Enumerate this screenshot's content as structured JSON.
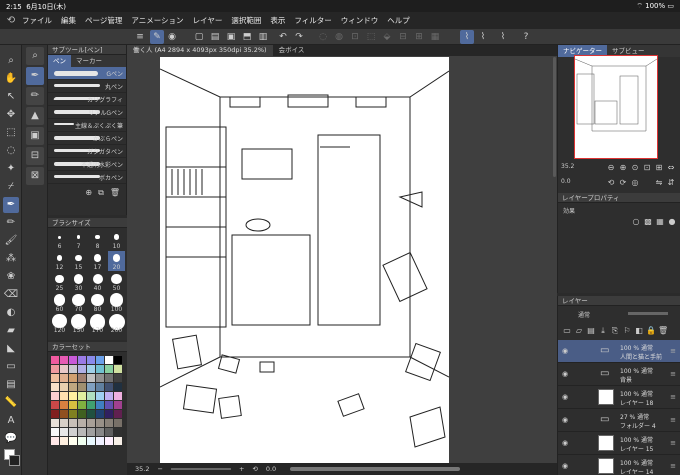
{
  "status": {
    "time": "2:15",
    "date": "6月10日(木)",
    "battery": "100%"
  },
  "menu": [
    "ファイル",
    "編集",
    "ページ管理",
    "アニメーション",
    "レイヤー",
    "選択範囲",
    "表示",
    "フィルター",
    "ウィンドウ",
    "ヘルプ"
  ],
  "subtool": {
    "title": "サブツール[ペン]",
    "tabs": [
      "ペン",
      "マーカー"
    ],
    "brushes": [
      "Gペン",
      "丸ペン",
      "カリグラフィ",
      "リアルGペン",
      "主線＆ぷくぷく筆",
      "かぶらペン",
      "ガタガタペン",
      "不透明水彩ペン",
      "ボカペン"
    ]
  },
  "brushsize": {
    "title": "ブラシサイズ",
    "sizes": [
      "6",
      "7",
      "8",
      "10",
      "12",
      "15",
      "17",
      "20",
      "25",
      "30",
      "40",
      "50",
      "60",
      "70",
      "80",
      "100",
      "120",
      "150",
      "170",
      "200"
    ],
    "selected": "20"
  },
  "colorset": {
    "title": "カラーセット"
  },
  "document": {
    "tab1": "働く人 (A4 2894 x 4093px 350dpi 35.2%)",
    "tab2": "会ボイス"
  },
  "bottombar": {
    "zoom": "35.2",
    "minus": "−",
    "plus": "+",
    "angle": "0.0"
  },
  "navigator": {
    "title": "ナビゲーター",
    "tab2": "サブビュー",
    "zoom": "35.2",
    "angle": "0.0"
  },
  "layerprop": {
    "title": "レイヤープロパティ",
    "effect": "効果"
  },
  "layers": {
    "title": "レイヤー",
    "blend": "通常",
    "rows": [
      {
        "line1": "100 % 通常",
        "line2": "人間と猫と手前",
        "type": "folder",
        "selected": true
      },
      {
        "line1": "100 % 通常",
        "line2": "背景",
        "type": "folder",
        "selected": false
      },
      {
        "line1": "100 % 通常",
        "line2": "レイヤー 18",
        "type": "layer",
        "selected": false
      },
      {
        "line1": "27 % 通常",
        "line2": "フォルダー 4",
        "type": "folder",
        "selected": false
      },
      {
        "line1": "100 % 通常",
        "line2": "レイヤー 15",
        "type": "layer",
        "selected": false
      },
      {
        "line1": "100 % 通常",
        "line2": "レイヤー 14",
        "type": "layer",
        "selected": false
      }
    ]
  },
  "swatches": [
    "#f25aa0",
    "#e85ab4",
    "#c85ad8",
    "#9a7ae6",
    "#8a8aea",
    "#6aa0ea",
    "#ffffff",
    "#000000",
    "#f09aa0",
    "#e8c8c8",
    "#c8c8d0",
    "#b0b0e6",
    "#a0d0e8",
    "#70c0d0",
    "#88d0a0",
    "#d0e0a0",
    "#f0c0a0",
    "#e0b090",
    "#d0a070",
    "#a08070",
    "#c0c0c0",
    "#909090",
    "#707070",
    "#404040",
    "#f8e0c8",
    "#e8d0b0",
    "#c0a880",
    "#a09070",
    "#80a0c0",
    "#6080a0",
    "#405070",
    "#203040",
    "#ffd0d0",
    "#ffe0b0",
    "#fff0a0",
    "#e0f0a0",
    "#b0e0c0",
    "#a0d0f0",
    "#c0b0f0",
    "#f0b0e0",
    "#c84848",
    "#d88040",
    "#d8c040",
    "#80b040",
    "#40a070",
    "#4080c0",
    "#6050b0",
    "#a04090",
    "#802020",
    "#905020",
    "#808020",
    "#406020",
    "#205040",
    "#204070",
    "#302060",
    "#602050",
    "#e8e0d8",
    "#d8d0c8",
    "#c8c0b8",
    "#b8b0a8",
    "#a8a098",
    "#989088",
    "#888078",
    "#787068",
    "#f8f8f8",
    "#e8e8e8",
    "#d0d0d0",
    "#b8b8b8",
    "#a0a0a0",
    "#888888",
    "#606060",
    "#303030",
    "#ffe8e8",
    "#fff0e0",
    "#fffff0",
    "#f0fff0",
    "#e8f8ff",
    "#f0f0ff",
    "#fff0ff",
    "#f8f0e8"
  ]
}
